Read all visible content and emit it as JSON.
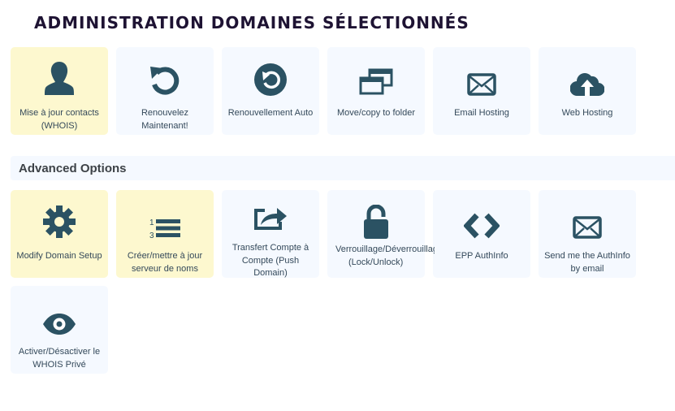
{
  "page": {
    "title": "ADMINISTRATION DOMAINES SÉLECTIONNÉS"
  },
  "colors": {
    "icon": "#2b5263",
    "tile_bg": "#f5f9ff",
    "tile_highlight": "#fdf8cf",
    "title": "#1e1333",
    "text": "#34495a"
  },
  "top_actions": [
    {
      "label": "Mise à jour contacts (WHOIS)",
      "icon": "user-icon",
      "highlighted": true
    },
    {
      "label": "Renouvelez Maintenant!",
      "icon": "undo-icon",
      "highlighted": false
    },
    {
      "label": "Renouvellement Auto",
      "icon": "auto-renew-icon",
      "highlighted": false
    },
    {
      "label": "Move/copy to folder",
      "icon": "windows-icon",
      "highlighted": false
    },
    {
      "label": "Email Hosting",
      "icon": "envelope-icon",
      "highlighted": false
    },
    {
      "label": "Web Hosting",
      "icon": "cloud-upload-icon",
      "highlighted": false
    }
  ],
  "advanced": {
    "heading": "Advanced Options",
    "actions": [
      {
        "label": "Modify Domain Setup",
        "icon": "gear-icon",
        "highlighted": true
      },
      {
        "label": "Créer/mettre à jour serveur de noms",
        "icon": "ordered-list-icon",
        "highlighted": true
      },
      {
        "label": "Transfert Compte à Compte (Push Domain)",
        "icon": "share-icon",
        "highlighted": false
      },
      {
        "label": "Verrouillage/Déverrouillage (Lock/Unlock)",
        "label_line1": "Verrouillage/Déverrouillage",
        "label_line2": "(Lock/Unlock)",
        "icon": "unlock-icon",
        "highlighted": false
      },
      {
        "label": "EPP AuthInfo",
        "icon": "code-icon",
        "highlighted": false
      },
      {
        "label": "Send me the AuthInfo by email",
        "icon": "envelope-icon",
        "highlighted": false
      },
      {
        "label": "Activer/Désactiver le WHOIS Privé",
        "icon": "eye-icon",
        "highlighted": false
      }
    ]
  }
}
